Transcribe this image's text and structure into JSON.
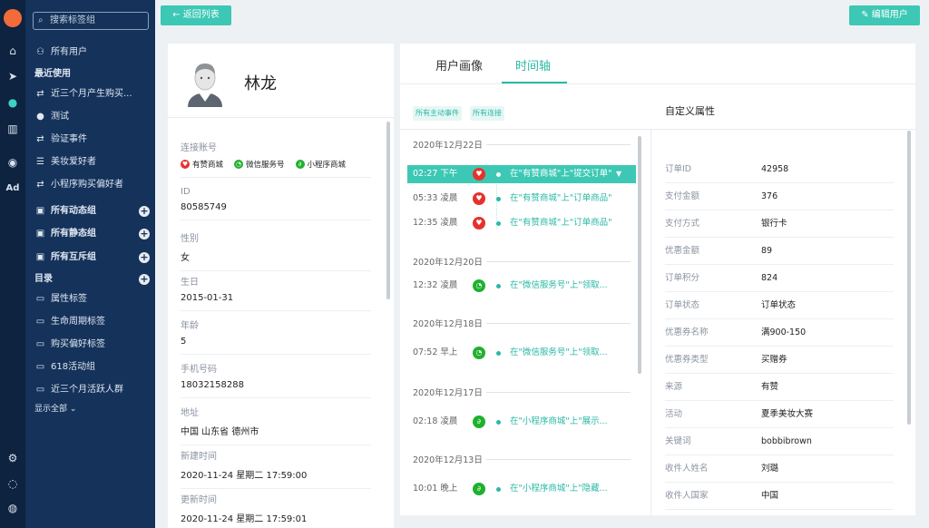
{
  "sidebar": {
    "search_placeholder": "搜索标签组",
    "all_users": "所有用户",
    "recent_heading": "最近使用",
    "recent": [
      {
        "icon": "loop-icon",
        "label": "近三个月产生购买..."
      },
      {
        "icon": "user-circle-icon",
        "label": "测试"
      },
      {
        "icon": "loop-icon",
        "label": "验证事件"
      },
      {
        "icon": "list-icon",
        "label": "美妆爱好者"
      },
      {
        "icon": "loop-icon",
        "label": "小程序购买偏好者"
      }
    ],
    "groups": [
      "所有动态组",
      "所有静态组",
      "所有互斥组"
    ],
    "dir_heading": "目录",
    "folders": [
      "属性标签",
      "生命周期标签",
      "购买偏好标签",
      "618活动组",
      "近三个月活跃人群"
    ],
    "show_all": "显示全部"
  },
  "header": {
    "back_label": "返回列表",
    "edit_label": "编辑用户"
  },
  "profile": {
    "name": "林龙",
    "linked_label": "连接账号",
    "linked": [
      {
        "name": "有赞商城",
        "color": "#e5322d",
        "icon": "thumb-icon"
      },
      {
        "name": "微信服务号",
        "color": "#1fb12e",
        "icon": "wechat-icon"
      },
      {
        "name": "小程序商城",
        "color": "#1fb12e",
        "icon": "mini-program-icon"
      }
    ],
    "fields": [
      {
        "label": "ID",
        "value": "80585749"
      },
      {
        "label": "性别",
        "value": "女"
      },
      {
        "label": "生日",
        "value": "2015-01-31"
      },
      {
        "label": "年龄",
        "value": "5"
      },
      {
        "label": "手机号码",
        "value": "18032158288"
      },
      {
        "label": "地址",
        "value": "中国 山东省 德州市"
      },
      {
        "label": "新建时间",
        "value": "2020-11-24 星期二 17:59:00"
      },
      {
        "label": "更新时间",
        "value": "2020-11-24 星期二 17:59:01"
      }
    ]
  },
  "tabs": [
    "用户画像",
    "时间轴"
  ],
  "chips": [
    "所有主动事件",
    "所有连接"
  ],
  "timeline": [
    {
      "date": "2020年12月22日",
      "events": [
        {
          "time": "02:27 下午",
          "text": "在\"有赞商城\"上\"提交订单\"",
          "color": "#e5322d",
          "selected": true
        },
        {
          "time": "05:33 凌晨",
          "text": "在\"有赞商城\"上\"订单商品\"",
          "color": "#e5322d",
          "selected": false
        },
        {
          "time": "12:35 凌晨",
          "text": "在\"有赞商城\"上\"订单商品\"",
          "color": "#e5322d",
          "selected": false
        }
      ]
    },
    {
      "date": "2020年12月20日",
      "events": [
        {
          "time": "12:32 凌晨",
          "text": "在\"微信服务号\"上\"领取...",
          "color": "#1fb12e",
          "selected": false
        }
      ]
    },
    {
      "date": "2020年12月18日",
      "events": [
        {
          "time": "07:52 早上",
          "text": "在\"微信服务号\"上\"领取...",
          "color": "#1fb12e",
          "selected": false
        }
      ]
    },
    {
      "date": "2020年12月17日",
      "events": [
        {
          "time": "02:18 凌晨",
          "text": "在\"小程序商城\"上\"展示...",
          "color": "#1fb12e",
          "selected": false
        }
      ]
    },
    {
      "date": "2020年12月13日",
      "events": [
        {
          "time": "10:01 晚上",
          "text": "在\"小程序商城\"上\"隐藏...",
          "color": "#1fb12e",
          "selected": false
        }
      ]
    }
  ],
  "attributes": {
    "title": "自定义属性",
    "rows": [
      {
        "k": "订单ID",
        "v": "42958"
      },
      {
        "k": "支付金额",
        "v": "376"
      },
      {
        "k": "支付方式",
        "v": "银行卡"
      },
      {
        "k": "优惠金额",
        "v": "89"
      },
      {
        "k": "订单积分",
        "v": "824"
      },
      {
        "k": "订单状态",
        "v": "订单状态"
      },
      {
        "k": "优惠券名称",
        "v": "满900-150"
      },
      {
        "k": "优惠券类型",
        "v": "买赠券"
      },
      {
        "k": "来源",
        "v": "有赞"
      },
      {
        "k": "活动",
        "v": "夏季美妆大赛"
      },
      {
        "k": "关键词",
        "v": "bobbibrown"
      },
      {
        "k": "收件人姓名",
        "v": "刘璐"
      },
      {
        "k": "收件人国家",
        "v": "中国"
      }
    ]
  },
  "colors": {
    "accent": "#3cc8b4",
    "sidebar": "#14325a",
    "rail": "#0d2340"
  }
}
